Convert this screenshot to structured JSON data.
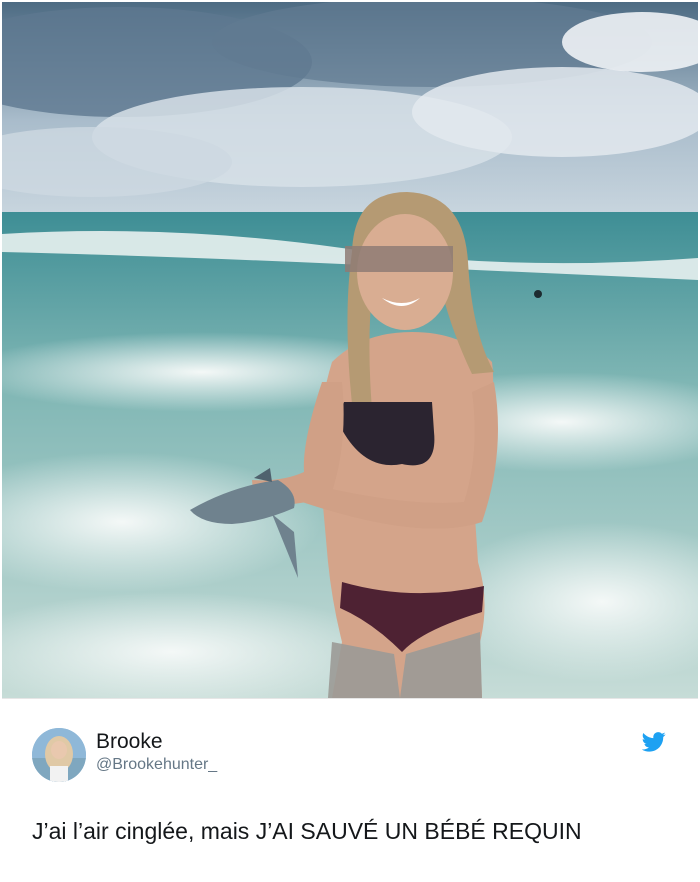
{
  "tweet": {
    "display_name": "Brooke",
    "handle": "@Brookehunter_",
    "text": "J’ai l’air cinglée, mais J’AI SAUVÉ UN BÉBÉ REQUIN",
    "brand_icon": "twitter-bird-icon"
  },
  "colors": {
    "brand": "#1da1f2",
    "name": "#14171a",
    "handle": "#657786"
  }
}
